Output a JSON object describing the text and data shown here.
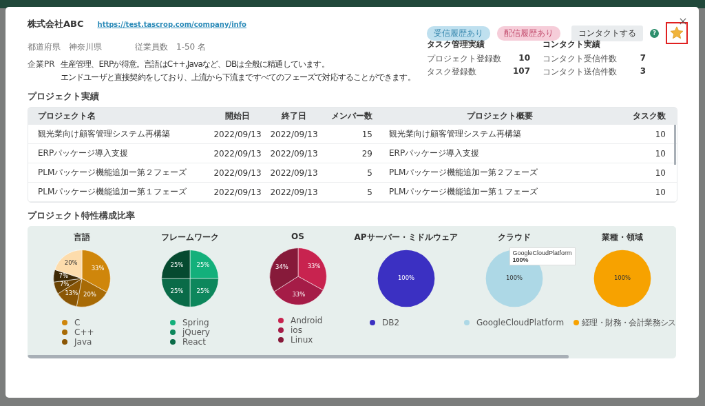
{
  "company": {
    "name": "株式会社ABC",
    "url": "https://test.tascrop.com/company/info",
    "prefecture_label": "都道府県",
    "prefecture": "神奈川県",
    "employees_label": "従業員数",
    "employees": "1-50 名",
    "pr_label": "企業PR",
    "pr_lines": [
      "生産管理、ERPが得意。言語はC++,Javaなど、DBは全般に精通しています。",
      "エンドユーザと直接契約をしており、上流から下流まですべてのフェーズで対応することができます。"
    ]
  },
  "badges": [
    {
      "label": "受信履歴あり",
      "color": "#bfe0ef"
    },
    {
      "label": "配信履歴あり",
      "color": "#f6cdd9"
    }
  ],
  "contact_button": "コンタクトする",
  "help_icon": "?",
  "favorite": {
    "on": true,
    "highlighted": true
  },
  "stats": [
    {
      "title": "タスク管理実績",
      "rows": [
        {
          "label": "プロジェクト登録数",
          "value": "10"
        },
        {
          "label": "タスク登録数",
          "value": "107"
        }
      ]
    },
    {
      "title": "コンタクト実績",
      "rows": [
        {
          "label": "コンタクト受信件数",
          "value": "7"
        },
        {
          "label": "コンタクト送信件数",
          "value": "3"
        }
      ]
    }
  ],
  "projects": {
    "title": "プロジェクト実績",
    "columns": [
      "プロジェクト名",
      "開始日",
      "終了日",
      "メンバー数",
      "プロジェクト概要",
      "タスク数"
    ],
    "rows": [
      [
        "観光業向け顧客管理システム再構築",
        "2022/09/13",
        "2022/09/13",
        "15",
        "観光業向け顧客管理システム再構築",
        "10"
      ],
      [
        "ERPパッケージ導入支援",
        "2022/09/13",
        "2022/09/13",
        "29",
        "ERPパッケージ導入支援",
        "10"
      ],
      [
        "PLMパッケージ機能追加ー第２フェーズ",
        "2022/09/13",
        "2022/09/13",
        "5",
        "PLMパッケージ機能追加ー第２フェーズ",
        "10"
      ],
      [
        "PLMパッケージ機能追加ー第１フェーズ",
        "2022/09/13",
        "2022/09/13",
        "5",
        "PLMパッケージ機能追加ー第１フェーズ",
        "10"
      ]
    ]
  },
  "composition": {
    "title": "プロジェクト特性構成比率",
    "charts": [
      {
        "chart_data": {
          "type": "pie",
          "title": "言語",
          "values": [
            33,
            20,
            13,
            7,
            7,
            20
          ],
          "value_labels": [
            "33%",
            "20%",
            "13%",
            "7%",
            "7%",
            "20%"
          ],
          "colors": [
            "#cf860b",
            "#a86b06",
            "#8a5605",
            "#6a4304",
            "#3e2906",
            "#fddcac"
          ]
        },
        "legend": [
          {
            "label": "C",
            "color": "#cf860b"
          },
          {
            "label": "C++",
            "color": "#a86b06"
          },
          {
            "label": "Java",
            "color": "#8a5605"
          }
        ]
      },
      {
        "chart_data": {
          "type": "pie",
          "title": "フレームワーク",
          "values": [
            25,
            25,
            25,
            25
          ],
          "value_labels": [
            "25%",
            "25%",
            "25%",
            "25%"
          ],
          "colors": [
            "#13b07b",
            "#0d875c",
            "#0a6b48",
            "#064a30"
          ]
        },
        "legend": [
          {
            "label": "Spring",
            "color": "#13b07b"
          },
          {
            "label": "jQuery",
            "color": "#0d875c"
          },
          {
            "label": "React",
            "color": "#0a6b48"
          }
        ]
      },
      {
        "chart_data": {
          "type": "pie",
          "title": "OS",
          "values": [
            33,
            33,
            34
          ],
          "value_labels": [
            "33%",
            "33%",
            "34%"
          ],
          "colors": [
            "#c8234f",
            "#a51c47",
            "#871a3a"
          ]
        },
        "legend": [
          {
            "label": "Android",
            "color": "#c8234f"
          },
          {
            "label": "ios",
            "color": "#a51c47"
          },
          {
            "label": "Linux",
            "color": "#871a3a"
          }
        ]
      },
      {
        "chart_data": {
          "type": "pie",
          "title": "APサーバー・ミドルウェア",
          "values": [
            100
          ],
          "value_labels": [
            "100%"
          ],
          "colors": [
            "#3b30c2"
          ]
        },
        "legend": [
          {
            "label": "DB2",
            "color": "#3b30c2"
          }
        ]
      },
      {
        "chart_data": {
          "type": "pie",
          "title": "クラウド",
          "values": [
            100
          ],
          "value_labels": [
            "100%"
          ],
          "colors": [
            "#add8e6"
          ]
        },
        "legend": [
          {
            "label": "GoogleCloudPlatform",
            "color": "#add8e6"
          }
        ],
        "tooltip": {
          "name": "GoogleCloudPlatform",
          "value": "100%"
        }
      },
      {
        "chart_data": {
          "type": "pie",
          "title": "業種・領域",
          "values": [
            100
          ],
          "value_labels": [
            "100%"
          ],
          "colors": [
            "#f7a200"
          ]
        },
        "legend": [
          {
            "label": "経理・財務・会計業務シス",
            "color": "#f7a200"
          }
        ]
      }
    ]
  }
}
